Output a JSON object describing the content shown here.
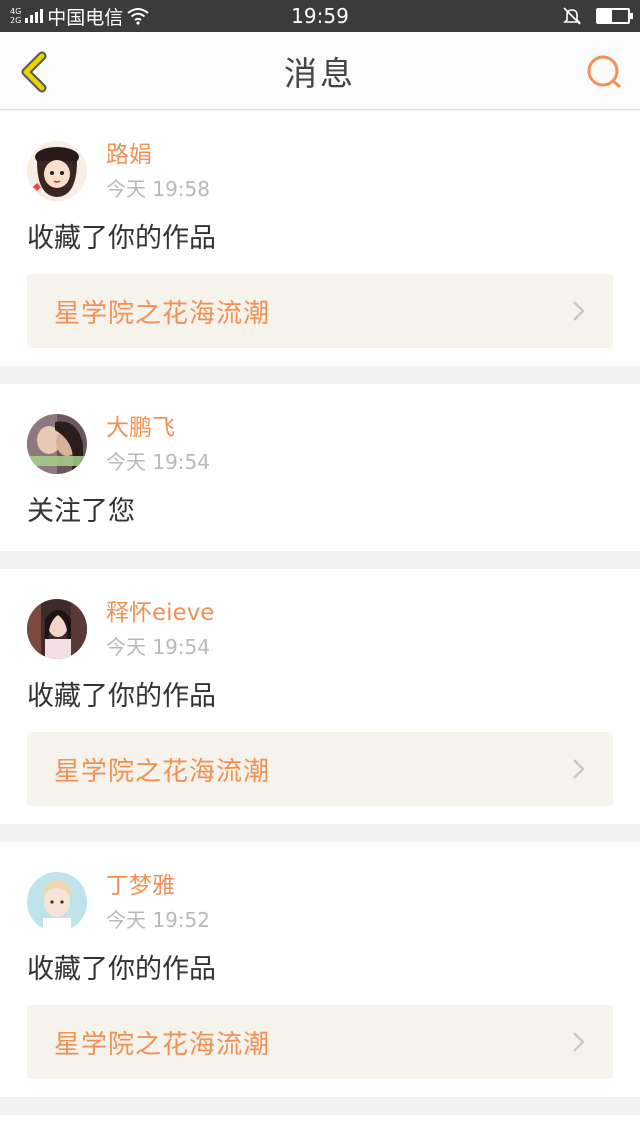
{
  "status_bar": {
    "net_top": "4G",
    "net_bottom": "2G",
    "carrier": "中国电信",
    "time": "19:59",
    "battery_level": 0.45
  },
  "nav": {
    "title": "消息",
    "back_icon": "chevron-left-icon",
    "search_icon": "search-icon"
  },
  "colors": {
    "accent": "#f09155",
    "back_icon": "#e8d200"
  },
  "messages": [
    {
      "name": "路娟",
      "time": "今天 19:58",
      "action": "收藏了你的作品",
      "work": "星学院之花海流潮"
    },
    {
      "name": "大鹏飞",
      "time": "今天 19:54",
      "action": "关注了您",
      "work": null
    },
    {
      "name": "释怀eieve",
      "time": "今天 19:54",
      "action": "收藏了你的作品",
      "work": "星学院之花海流潮"
    },
    {
      "name": "丁梦雅",
      "time": "今天 19:52",
      "action": "收藏了你的作品",
      "work": "星学院之花海流潮"
    }
  ]
}
